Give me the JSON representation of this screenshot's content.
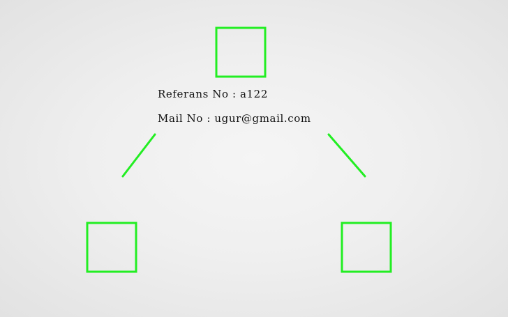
{
  "info": {
    "referans": "Referans No : a122",
    "mail": "Mail No : ugur@gmail.com"
  },
  "colors": {
    "frame": "#22ee22",
    "text": "#111111"
  }
}
